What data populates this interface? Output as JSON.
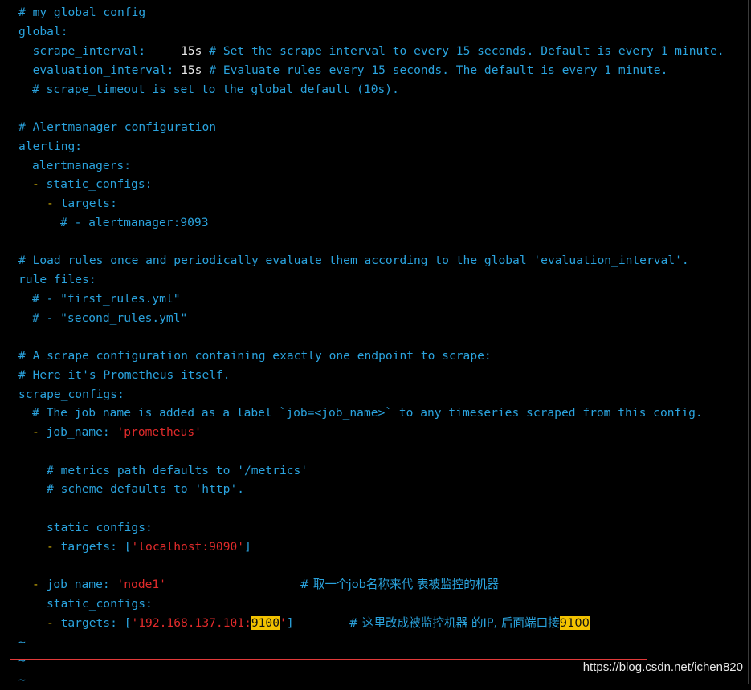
{
  "lines": {
    "l1": "# my global config",
    "l2": "global:",
    "l3_key": "scrape_interval:",
    "l3_val": "15s",
    "l3_comment": "# Set the scrape interval to every 15 seconds. Default is every 1 minute.",
    "l4_key": "evaluation_interval:",
    "l4_val": "15s",
    "l4_comment": "# Evaluate rules every 15 seconds. The default is every 1 minute.",
    "l5": "# scrape_timeout is set to the global default (10s).",
    "l7": "# Alertmanager configuration",
    "l8": "alerting:",
    "l9": "alertmanagers:",
    "l10_dash": "-",
    "l10_key": "static_configs:",
    "l11_dash": "-",
    "l11_key": "targets:",
    "l12": "# - alertmanager:9093",
    "l14": "# Load rules once and periodically evaluate them according to the global 'evaluation_interval'.",
    "l15": "rule_files:",
    "l16": "# - \"first_rules.yml\"",
    "l17": "# - \"second_rules.yml\"",
    "l19": "# A scrape configuration containing exactly one endpoint to scrape:",
    "l20": "# Here it's Prometheus itself.",
    "l21": "scrape_configs:",
    "l22": "# The job name is added as a label `job=<job_name>` to any timeseries scraped from this config.",
    "l23_dash": "-",
    "l23_key": "job_name:",
    "l23_val": "'prometheus'",
    "l25": "# metrics_path defaults to '/metrics'",
    "l26": "# scheme defaults to 'http'.",
    "l28": "static_configs:",
    "l29_dash": "-",
    "l29_key": "targets:",
    "l29_open": "[",
    "l29_val": "'localhost:9090'",
    "l29_close": "]",
    "l31_dash": "-",
    "l31_key": "job_name:",
    "l31_val": "'node1'",
    "l31_comment": "# 取一个job名称来代 表被监控的机器",
    "l32": "static_configs:",
    "l33_dash": "-",
    "l33_key": "targets:",
    "l33_open": "[",
    "l33_val_a": "'192.168.137.101:",
    "l33_val_hl": "9100",
    "l33_val_b": "'",
    "l33_close": "]",
    "l33_comment": "# 这里改成被监控机器 的IP, 后面端口接",
    "l33_comment_hl": "9100",
    "tilde": "~"
  },
  "watermark": "https://blog.csdn.net/ichen820",
  "colors": {
    "background": "#000000",
    "key": "#2aa3de",
    "string": "#e12b2b",
    "dash": "#d4b106",
    "highlight": "#f2c200",
    "box": "#e23a3a"
  }
}
